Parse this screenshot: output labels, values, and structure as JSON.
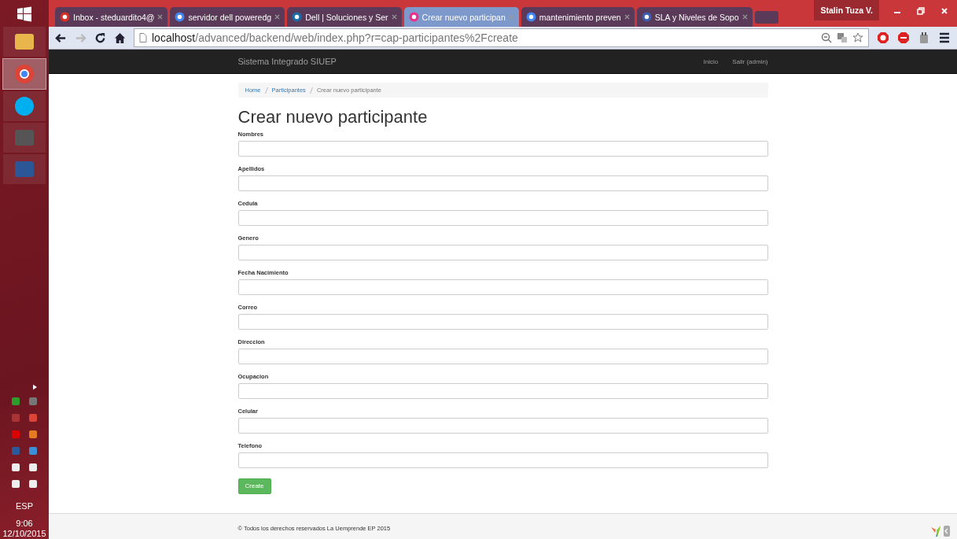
{
  "taskbar": {
    "language": "ESP",
    "time": "9:06",
    "date": "12/10/2015"
  },
  "browser": {
    "tabs": [
      {
        "title": "Inbox - steduardito4@",
        "selected": false
      },
      {
        "title": "servidor dell poweredg",
        "selected": false
      },
      {
        "title": "Dell | Soluciones y Ser",
        "selected": false
      },
      {
        "title": "Crear nuevo participan",
        "selected": true
      },
      {
        "title": "mantenimiento preven",
        "selected": false
      },
      {
        "title": "SLA y Niveles de Sopo",
        "selected": false
      }
    ],
    "user": "Stalin Tuza V.",
    "url_host": "localhost",
    "url_path": "/advanced/backend/web/index.php?r=cap-participantes%2Fcreate"
  },
  "navbar": {
    "brand": "Sistema Integrado SIUEP",
    "links": [
      "Inicio",
      "Salir (admin)"
    ]
  },
  "breadcrumb": [
    {
      "label": "Home",
      "link": true
    },
    {
      "label": "Participantes",
      "link": true
    },
    {
      "label": "Crear nuevo participante",
      "link": false
    }
  ],
  "title": "Crear nuevo participante",
  "fields": [
    {
      "label": "Nombres"
    },
    {
      "label": "Apellidos"
    },
    {
      "label": "Cedula"
    },
    {
      "label": "Genero"
    },
    {
      "label": "Fecha Nacimiento"
    },
    {
      "label": "Correo"
    },
    {
      "label": "Direccion"
    },
    {
      "label": "Ocupacion"
    },
    {
      "label": "Celular"
    },
    {
      "label": "Telefono"
    }
  ],
  "submit": "Create",
  "footer": "© Todos los derechos reservados La Uemprende EP 2015"
}
